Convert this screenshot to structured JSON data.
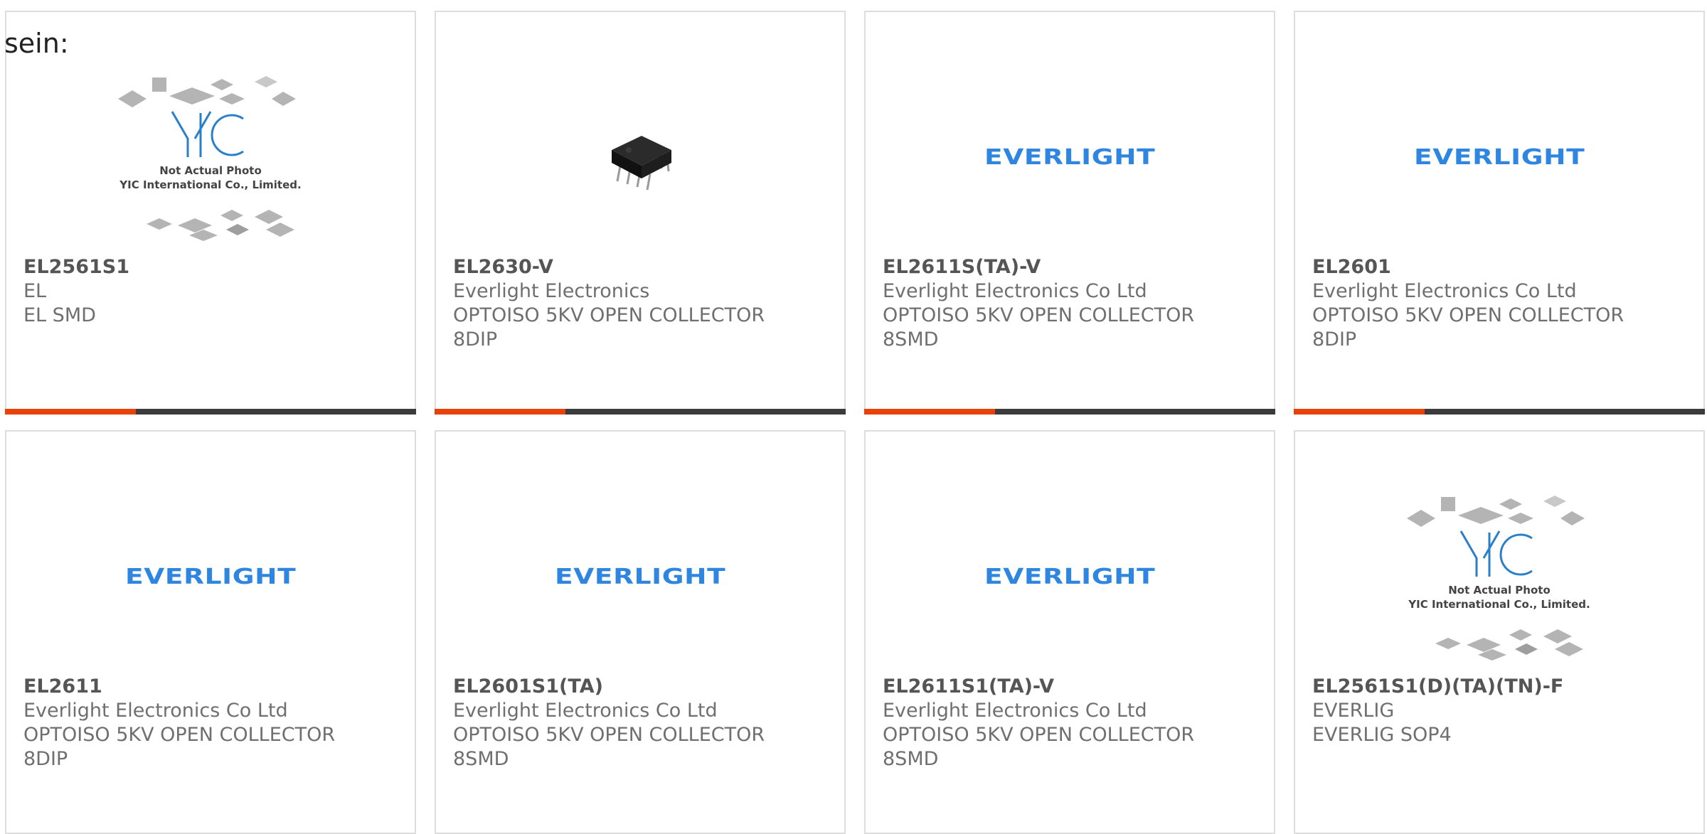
{
  "intro_text": "sein:",
  "cards": [
    {
      "part_number": "EL2561S1",
      "manufacturer": "EL",
      "description": "EL SMD",
      "package": "",
      "image": "yic-placeholder",
      "placeholder_caption_1": "Not Actual Photo",
      "placeholder_caption_2": "YIC International Co., Limited."
    },
    {
      "part_number": "EL2630-V",
      "manufacturer": "Everlight Electronics",
      "description": "OPTOISO 5KV OPEN COLLECTOR",
      "package": "8DIP",
      "image": "dip8-chip-photo"
    },
    {
      "part_number": "EL2611S(TA)-V",
      "manufacturer": "Everlight Electronics Co Ltd",
      "description": "OPTOISO 5KV OPEN COLLECTOR",
      "package": "8SMD",
      "image": "everlight-logo",
      "logo_text": "EVERLIGHT"
    },
    {
      "part_number": "EL2601",
      "manufacturer": "Everlight Electronics Co Ltd",
      "description": "OPTOISO 5KV OPEN COLLECTOR",
      "package": "8DIP",
      "image": "everlight-logo",
      "logo_text": "EVERLIGHT"
    },
    {
      "part_number": "EL2611",
      "manufacturer": "Everlight Electronics Co Ltd",
      "description": "OPTOISO 5KV OPEN COLLECTOR",
      "package": "8DIP",
      "image": "everlight-logo",
      "logo_text": "EVERLIGHT"
    },
    {
      "part_number": "EL2601S1(TA)",
      "manufacturer": "Everlight Electronics Co Ltd",
      "description": "OPTOISO 5KV OPEN COLLECTOR",
      "package": "8SMD",
      "image": "everlight-logo",
      "logo_text": "EVERLIGHT"
    },
    {
      "part_number": "EL2611S1(TA)-V",
      "manufacturer": "Everlight Electronics Co Ltd",
      "description": "OPTOISO 5KV OPEN COLLECTOR",
      "package": "8SMD",
      "image": "everlight-logo",
      "logo_text": "EVERLIGHT"
    },
    {
      "part_number": "EL2561S1(D)(TA)(TN)-F",
      "manufacturer": "EVERLIG",
      "description": "EVERLIG SOP4",
      "package": "",
      "image": "yic-placeholder",
      "placeholder_caption_1": "Not Actual Photo",
      "placeholder_caption_2": "YIC International Co., Limited."
    }
  ],
  "colors": {
    "accent": "#e8420a",
    "bar": "#3b3b3b",
    "everlight_blue": "#2f86e0",
    "yic_blue": "#2a7fc9",
    "card_border": "#dddddd",
    "text": "#6f6f6f"
  }
}
